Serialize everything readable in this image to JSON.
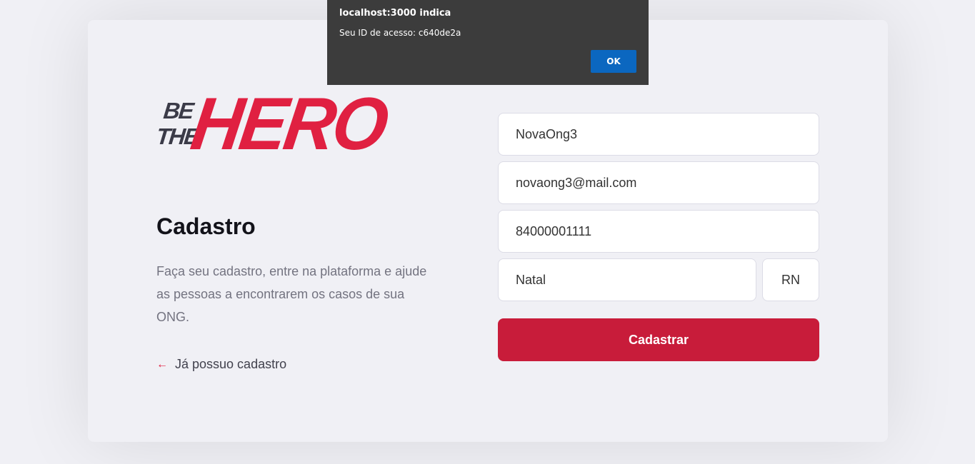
{
  "dialog": {
    "title": "localhost:3000 indica",
    "message": "Seu ID de acesso: c640de2a",
    "ok_label": "OK"
  },
  "logo": {
    "be": "BE",
    "the": "THE",
    "hero": "HERO",
    "colors": {
      "primary": "#e02041",
      "dark": "#3b3b48"
    }
  },
  "left": {
    "title": "Cadastro",
    "description": "Faça seu cadastro, entre na plataforma e ajude as pessoas a encontrarem os casos de sua ONG.",
    "back_link_icon": "arrow-left-icon",
    "back_link_arrow": "←",
    "back_link_label": "Já possuo cadastro"
  },
  "form": {
    "name": "NovaOng3",
    "email": "novaong3@mail.com",
    "whatsapp": "84000001111",
    "city": "Natal",
    "uf": "RN",
    "submit_label": "Cadastrar"
  },
  "colors": {
    "accent": "#c81c3a",
    "background": "#f0f0f5",
    "dialog_bg": "#3c3c3c",
    "dialog_button": "#0b67c0"
  }
}
